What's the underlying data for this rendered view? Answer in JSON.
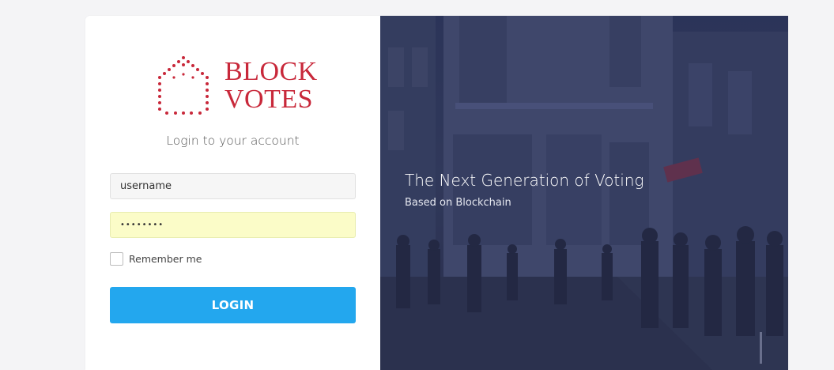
{
  "brand": {
    "line1": "BLOCK",
    "line2": "VOTES",
    "color": "#c8283a",
    "icon": "ballot-box-dots-icon"
  },
  "login": {
    "subtitle": "Login to your account",
    "username": {
      "value": "username",
      "placeholder": "username"
    },
    "password": {
      "value": "••••••••"
    },
    "remember_label": "Remember me",
    "button_label": "LOGIN",
    "button_color": "#23a7ee"
  },
  "hero": {
    "title": "The Next Generation of Voting",
    "subtitle": "Based on Blockchain",
    "overlay_color": "#2c3559"
  }
}
